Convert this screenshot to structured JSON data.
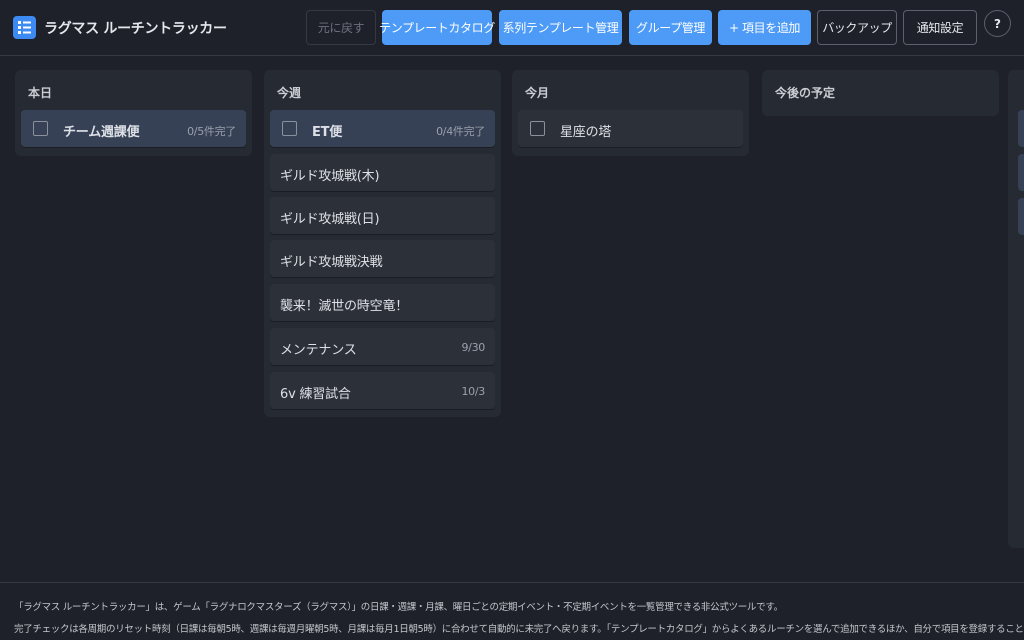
{
  "app": {
    "title": "ラグマス ルーチントラッカー"
  },
  "toolbar": {
    "undo_label": "元に戻す",
    "template_catalog_label": "テンプレートカタログ",
    "series_template_label": "系列テンプレート管理",
    "group_manage_label": "グループ管理",
    "add_item_label": "+ 項目を追加",
    "backup_label": "バックアップ",
    "notification_label": "通知設定",
    "help_label": "?"
  },
  "columns": {
    "today": {
      "title": "本日",
      "items": [
        {
          "label": "チーム週課便",
          "meta": "0/5件完了"
        }
      ]
    },
    "week": {
      "title": "今週",
      "items": [
        {
          "label": "ET便",
          "meta": "0/4件完了"
        },
        {
          "label": "ギルド攻城戦(木)",
          "meta": ""
        },
        {
          "label": "ギルド攻城戦(日)",
          "meta": ""
        },
        {
          "label": "ギルド攻城戦決戦",
          "meta": ""
        },
        {
          "label": "襲来！滅世の時空竜！",
          "meta": ""
        },
        {
          "label": "メンテナンス",
          "meta": "9/30"
        },
        {
          "label": "6v 練習試合",
          "meta": "10/3"
        }
      ]
    },
    "month": {
      "title": "今月",
      "items": [
        {
          "label": "星座の塔",
          "meta": ""
        }
      ]
    },
    "upcoming": {
      "title": "今後の予定",
      "items": []
    }
  },
  "footer": {
    "line1": "「ラグマス ルーチントラッカー」は、ゲーム「ラグナロクマスターズ（ラグマス）」の日課・週課・月課、曜日ごとの定期イベント・不定期イベントを一覧管理できる非公式ツールです。",
    "line2": "完了チェックは各周期のリセット時刻（日課は毎朝5時、週課は毎週月曜朝5時、月課は毎月1日朝5時）に合わせて自動的に未完了へ戻ります。「テンプレートカタログ」からよくあるルーチンを選んで追加できるほか、自分で項目を登録することもできま"
  },
  "colors": {
    "background": "#1e2129",
    "column": "#262a33",
    "card": "#2c3039",
    "card_active": "#364156",
    "primary": "#4d9bf7"
  },
  "icons": {
    "logo": "checklist-icon"
  }
}
